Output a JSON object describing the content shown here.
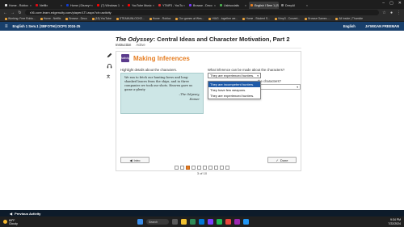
{
  "browser": {
    "tabs": [
      {
        "label": "Home - Roblox",
        "color": "#e2e2e2",
        "active": false
      },
      {
        "label": "Netflix",
        "color": "#e50914",
        "active": false
      },
      {
        "label": "Home | Disney+",
        "color": "#113ccf",
        "active": false
      },
      {
        "label": "(7) Windows 1",
        "color": "#ff0000",
        "active": false
      },
      {
        "label": "YouTube Music",
        "color": "#ff0000",
        "active": false
      },
      {
        "label": "YTMP3 - YouTu",
        "color": "#d33",
        "active": false
      },
      {
        "label": "Browse - Deco",
        "color": "#7a3cff",
        "active": false
      },
      {
        "label": "Usbisocialis",
        "color": "#4caf50",
        "active": false
      },
      {
        "label": "English I Sem 1 (SGFOTHI)",
        "color": "#e67e22",
        "active": true
      },
      {
        "label": "DeepAI",
        "color": "#888888",
        "active": false
      }
    ],
    "url": "r06.core.learn.edgenuity.com/player/LTI.aspx?ch=activity",
    "bookmarks": [
      "Working: Free Roblo...",
      "Home - Netflix",
      "Browse - Deco",
      "(18) YouTube",
      "STEAMUNLOCKE...",
      "Home - Roblox",
      "Our games at Wes...",
      "HIAG - together we...",
      "Home - Student S...",
      "Vimp3 - Convert...",
      "Browse Games -...",
      "All Inside | Thumble"
    ]
  },
  "header": {
    "course": "English 1 Sem.1 (SBFOTHI) DCPS 2024-25",
    "language": "English",
    "user": "JA'MIGAN FREEMAN"
  },
  "lesson": {
    "title_part1": "The Odyssey",
    "title_part2": ": Central Ideas and Character Motivation, Part 2",
    "tab_instruction": "Instruction",
    "tab_active": "Active"
  },
  "activity": {
    "badge": "Activity",
    "title": "Making Inferences",
    "left_prompt": "Highlight details about the characters.",
    "excerpt": "We ran to fetch our hunting bows and long-shanked lances from the ships, and in three companies we took our shots. Heaven gave us game a-plenty",
    "attribution_title": "–The Odyssey,",
    "attribution_author": "Homer",
    "right_prompt": "What inference can be made about the characters?",
    "dropdown_value": "They are experienced hunters.",
    "partial_prompt": "the characters?",
    "options": [
      "They are incompetent hunters.",
      "They have few weapons.",
      "They are experienced hunters."
    ],
    "selected_option": 0,
    "intro_button": "Intro",
    "done_button": "Done"
  },
  "pager": {
    "text": "3 of 10",
    "current": 3,
    "total": 10
  },
  "footer": {
    "previous_activity": "Previous Activity"
  },
  "taskbar": {
    "weather_temp": "69°F",
    "weather_desc": "Cloudy",
    "search_placeholder": "Search",
    "time": "9:34 PM",
    "date": "7/22/2024"
  }
}
